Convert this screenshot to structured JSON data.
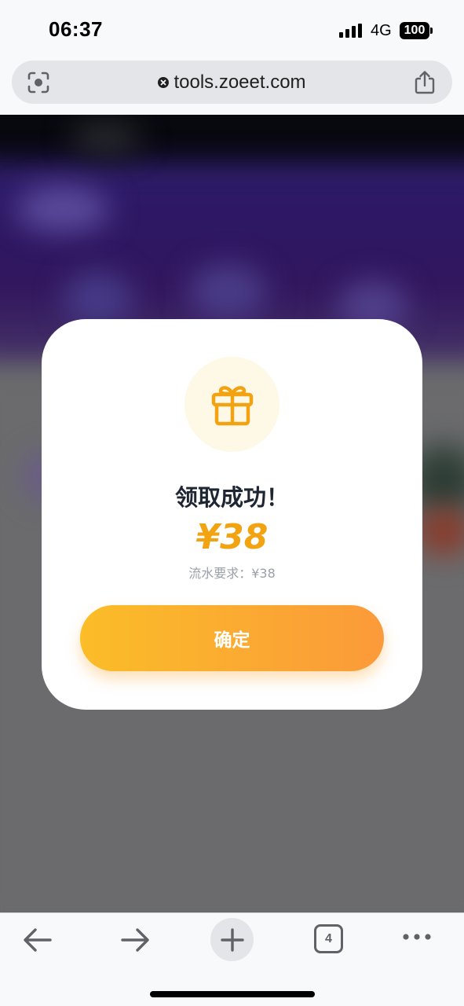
{
  "status_bar": {
    "time": "06:37",
    "network": "4G",
    "battery": "100"
  },
  "browser": {
    "url": "tools.zoeet.com",
    "tab_count": "4",
    "icons": {
      "lens": "google-lens-icon",
      "site_status": "site-blocked-icon",
      "share": "share-icon",
      "back": "arrow-left-icon",
      "forward": "arrow-right-icon",
      "new_tab": "plus-icon",
      "more": "more-dots-icon"
    }
  },
  "modal": {
    "icon": "gift-icon",
    "title": "领取成功！",
    "amount": "¥38",
    "requirement": "流水要求：¥38",
    "confirm_label": "确定"
  },
  "colors": {
    "accent": "#f2a312",
    "button_gradient_start": "#fbbd28",
    "button_gradient_end": "#fb9a3a",
    "gift_circle_bg": "#fef8e6",
    "title_text": "#1e2533",
    "requirement_text": "#9ba0a8",
    "overlay_grey": "#666769"
  }
}
